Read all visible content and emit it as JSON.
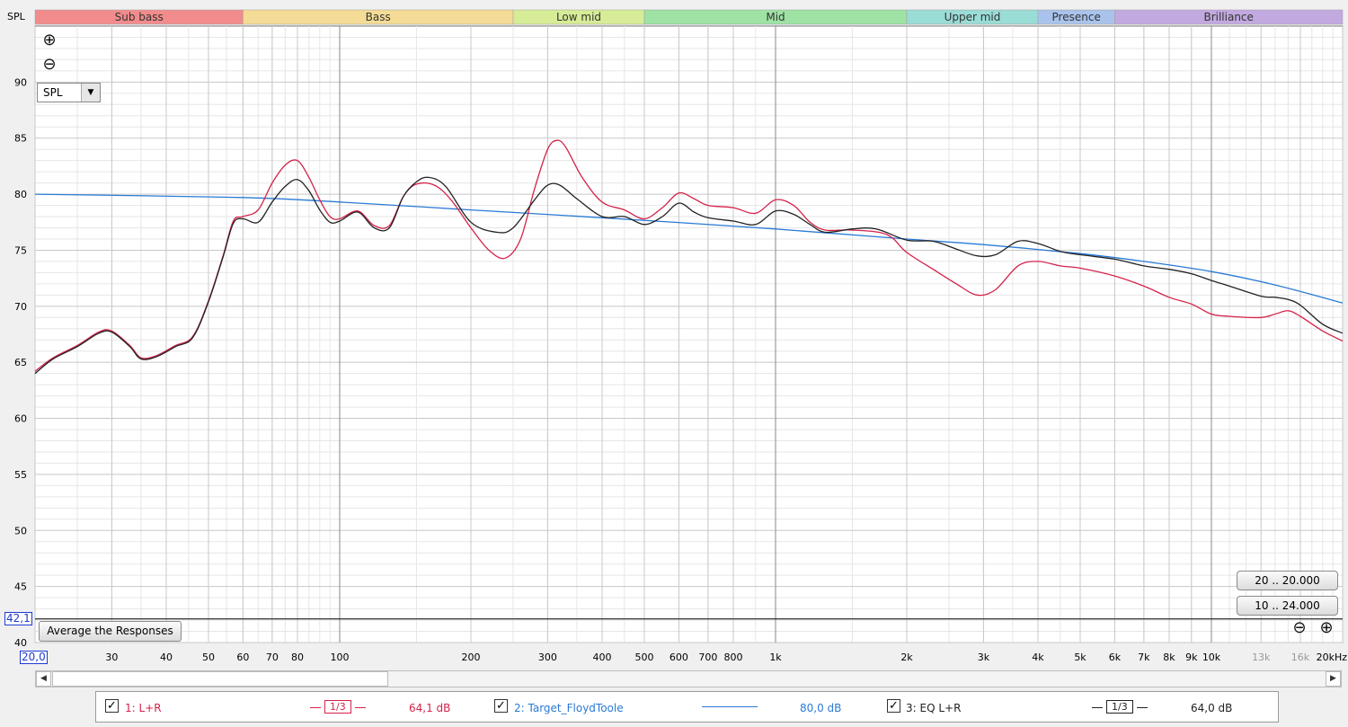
{
  "axis_title": "SPL",
  "zoom_in_icon": "zoom-in-icon",
  "zoom_out_icon": "zoom-out-icon",
  "select_value": "SPL",
  "range_buttons": [
    "20 .. 20.000",
    "10 .. 24.000"
  ],
  "average_button": "Average the Responses",
  "cursor": {
    "y_label": "42,1",
    "x_label": "20,0"
  },
  "legend": {
    "item1": {
      "name": "1: L+R",
      "smoothing": "1/3",
      "level": "64,1 dB",
      "color": "#d4234a"
    },
    "item2": {
      "name": "2: Target_FloydToole",
      "level": "80,0 dB",
      "color": "#2a7ad5"
    },
    "item3": {
      "name": "3: EQ L+R",
      "smoothing": "1/3",
      "level": "64,0 dB",
      "color": "#222222"
    }
  },
  "chart_data": {
    "type": "line",
    "x_scale": "log",
    "xlim": [
      20,
      20000
    ],
    "ylim": [
      40,
      95
    ],
    "grid": true,
    "ylabel": "SPL",
    "yticks": [
      40,
      45,
      50,
      55,
      60,
      65,
      70,
      75,
      80,
      85,
      90
    ],
    "xticks": [
      {
        "v": 20,
        "l": "20,0",
        "minor": false
      },
      {
        "v": 30,
        "l": "30",
        "minor": false
      },
      {
        "v": 40,
        "l": "40",
        "minor": false
      },
      {
        "v": 50,
        "l": "50",
        "minor": false
      },
      {
        "v": 60,
        "l": "60",
        "minor": false
      },
      {
        "v": 70,
        "l": "70",
        "minor": false
      },
      {
        "v": 80,
        "l": "80",
        "minor": false
      },
      {
        "v": 100,
        "l": "100",
        "minor": false
      },
      {
        "v": 200,
        "l": "200",
        "minor": false
      },
      {
        "v": 300,
        "l": "300",
        "minor": false
      },
      {
        "v": 400,
        "l": "400",
        "minor": false
      },
      {
        "v": 500,
        "l": "500",
        "minor": false
      },
      {
        "v": 600,
        "l": "600",
        "minor": false
      },
      {
        "v": 700,
        "l": "700",
        "minor": false
      },
      {
        "v": 800,
        "l": "800",
        "minor": false
      },
      {
        "v": 1000,
        "l": "1k",
        "minor": false
      },
      {
        "v": 2000,
        "l": "2k",
        "minor": false
      },
      {
        "v": 3000,
        "l": "3k",
        "minor": false
      },
      {
        "v": 4000,
        "l": "4k",
        "minor": false
      },
      {
        "v": 5000,
        "l": "5k",
        "minor": false
      },
      {
        "v": 6000,
        "l": "6k",
        "minor": false
      },
      {
        "v": 7000,
        "l": "7k",
        "minor": false
      },
      {
        "v": 8000,
        "l": "8k",
        "minor": false
      },
      {
        "v": 9000,
        "l": "9k",
        "minor": false
      },
      {
        "v": 10000,
        "l": "10k",
        "minor": false
      },
      {
        "v": 13000,
        "l": "13k",
        "minor": true
      },
      {
        "v": 16000,
        "l": "16k",
        "minor": true
      },
      {
        "v": 20000,
        "l": "20kHz",
        "minor": false
      }
    ],
    "bands": [
      {
        "name": "Sub bass",
        "from": 20,
        "to": 60,
        "color": "#f28c8c"
      },
      {
        "name": "Bass",
        "from": 60,
        "to": 250,
        "color": "#f5dc96"
      },
      {
        "name": "Low mid",
        "from": 250,
        "to": 500,
        "color": "#d6ec96"
      },
      {
        "name": "Mid",
        "from": 500,
        "to": 2000,
        "color": "#9ee2a4"
      },
      {
        "name": "Upper mid",
        "from": 2000,
        "to": 4000,
        "color": "#9adcd6"
      },
      {
        "name": "Presence",
        "from": 4000,
        "to": 6000,
        "color": "#a9c3ec"
      },
      {
        "name": "Brilliance",
        "from": 6000,
        "to": 20000,
        "color": "#c2a9e0"
      }
    ],
    "series": [
      {
        "name": "2: Target_FloydToole",
        "color": "#2a7ad5",
        "points": [
          [
            20,
            80.0
          ],
          [
            60,
            79.7
          ],
          [
            100,
            79.3
          ],
          [
            200,
            78.6
          ],
          [
            400,
            77.9
          ],
          [
            1000,
            76.9
          ],
          [
            2000,
            76.0
          ],
          [
            3000,
            75.5
          ],
          [
            5000,
            74.7
          ],
          [
            7000,
            74.0
          ],
          [
            10000,
            73.1
          ],
          [
            14000,
            71.9
          ],
          [
            20000,
            70.3
          ]
        ]
      },
      {
        "name": "1: L+R",
        "color": "#d4234a",
        "points": [
          [
            20,
            64.2
          ],
          [
            22,
            65.4
          ],
          [
            25,
            66.5
          ],
          [
            28,
            67.7
          ],
          [
            30,
            67.8
          ],
          [
            33,
            66.5
          ],
          [
            35,
            65.4
          ],
          [
            38,
            65.6
          ],
          [
            42,
            66.5
          ],
          [
            46,
            67.3
          ],
          [
            50,
            70.5
          ],
          [
            54,
            74.5
          ],
          [
            57,
            77.6
          ],
          [
            60,
            78.0
          ],
          [
            65,
            78.6
          ],
          [
            70,
            81.0
          ],
          [
            75,
            82.6
          ],
          [
            80,
            83.0
          ],
          [
            85,
            81.5
          ],
          [
            90,
            79.5
          ],
          [
            95,
            78.0
          ],
          [
            100,
            77.8
          ],
          [
            110,
            78.5
          ],
          [
            120,
            77.2
          ],
          [
            130,
            77.2
          ],
          [
            140,
            79.8
          ],
          [
            150,
            80.9
          ],
          [
            165,
            80.8
          ],
          [
            180,
            79.5
          ],
          [
            200,
            77.0
          ],
          [
            220,
            75.0
          ],
          [
            240,
            74.3
          ],
          [
            260,
            76.0
          ],
          [
            280,
            80.5
          ],
          [
            300,
            84.0
          ],
          [
            315,
            84.8
          ],
          [
            330,
            84.2
          ],
          [
            360,
            81.5
          ],
          [
            400,
            79.3
          ],
          [
            450,
            78.6
          ],
          [
            500,
            77.8
          ],
          [
            550,
            78.8
          ],
          [
            600,
            80.1
          ],
          [
            650,
            79.6
          ],
          [
            700,
            79.0
          ],
          [
            800,
            78.8
          ],
          [
            900,
            78.3
          ],
          [
            1000,
            79.5
          ],
          [
            1100,
            79.0
          ],
          [
            1200,
            77.5
          ],
          [
            1300,
            76.8
          ],
          [
            1500,
            76.8
          ],
          [
            1800,
            76.4
          ],
          [
            2000,
            74.8
          ],
          [
            2300,
            73.3
          ],
          [
            2600,
            72.0
          ],
          [
            2900,
            71.0
          ],
          [
            3200,
            71.5
          ],
          [
            3600,
            73.6
          ],
          [
            4000,
            74.0
          ],
          [
            4500,
            73.6
          ],
          [
            5000,
            73.4
          ],
          [
            6000,
            72.7
          ],
          [
            7000,
            71.8
          ],
          [
            8000,
            70.8
          ],
          [
            9000,
            70.2
          ],
          [
            10000,
            69.3
          ],
          [
            11000,
            69.1
          ],
          [
            13000,
            69.0
          ],
          [
            14000,
            69.3
          ],
          [
            15000,
            69.6
          ],
          [
            16000,
            69.1
          ],
          [
            18000,
            67.8
          ],
          [
            20000,
            66.9
          ]
        ]
      },
      {
        "name": "3: EQ L+R",
        "color": "#222222",
        "points": [
          [
            20,
            64.0
          ],
          [
            22,
            65.3
          ],
          [
            25,
            66.4
          ],
          [
            28,
            67.6
          ],
          [
            30,
            67.7
          ],
          [
            33,
            66.4
          ],
          [
            35,
            65.3
          ],
          [
            38,
            65.5
          ],
          [
            42,
            66.4
          ],
          [
            46,
            67.2
          ],
          [
            50,
            70.4
          ],
          [
            54,
            74.4
          ],
          [
            57,
            77.4
          ],
          [
            60,
            77.8
          ],
          [
            65,
            77.5
          ],
          [
            70,
            79.3
          ],
          [
            75,
            80.7
          ],
          [
            80,
            81.3
          ],
          [
            85,
            80.3
          ],
          [
            90,
            78.6
          ],
          [
            95,
            77.5
          ],
          [
            100,
            77.6
          ],
          [
            110,
            78.4
          ],
          [
            120,
            77.0
          ],
          [
            130,
            77.0
          ],
          [
            140,
            79.8
          ],
          [
            150,
            81.1
          ],
          [
            160,
            81.5
          ],
          [
            175,
            80.7
          ],
          [
            200,
            77.5
          ],
          [
            230,
            76.6
          ],
          [
            250,
            77.0
          ],
          [
            280,
            79.5
          ],
          [
            300,
            80.8
          ],
          [
            320,
            80.8
          ],
          [
            350,
            79.6
          ],
          [
            400,
            78.0
          ],
          [
            450,
            78.0
          ],
          [
            500,
            77.3
          ],
          [
            550,
            78.0
          ],
          [
            600,
            79.2
          ],
          [
            650,
            78.4
          ],
          [
            700,
            77.9
          ],
          [
            800,
            77.6
          ],
          [
            900,
            77.3
          ],
          [
            1000,
            78.5
          ],
          [
            1100,
            78.2
          ],
          [
            1200,
            77.3
          ],
          [
            1300,
            76.6
          ],
          [
            1500,
            76.9
          ],
          [
            1700,
            76.9
          ],
          [
            2000,
            75.9
          ],
          [
            2300,
            75.8
          ],
          [
            2600,
            75.1
          ],
          [
            2900,
            74.5
          ],
          [
            3200,
            74.6
          ],
          [
            3600,
            75.8
          ],
          [
            4000,
            75.6
          ],
          [
            4500,
            74.9
          ],
          [
            5000,
            74.6
          ],
          [
            6000,
            74.2
          ],
          [
            7000,
            73.6
          ],
          [
            8000,
            73.3
          ],
          [
            9000,
            72.9
          ],
          [
            10000,
            72.3
          ],
          [
            11000,
            71.8
          ],
          [
            13000,
            70.9
          ],
          [
            14000,
            70.8
          ],
          [
            15000,
            70.6
          ],
          [
            16000,
            70.1
          ],
          [
            18000,
            68.4
          ],
          [
            20000,
            67.6
          ]
        ]
      }
    ]
  }
}
